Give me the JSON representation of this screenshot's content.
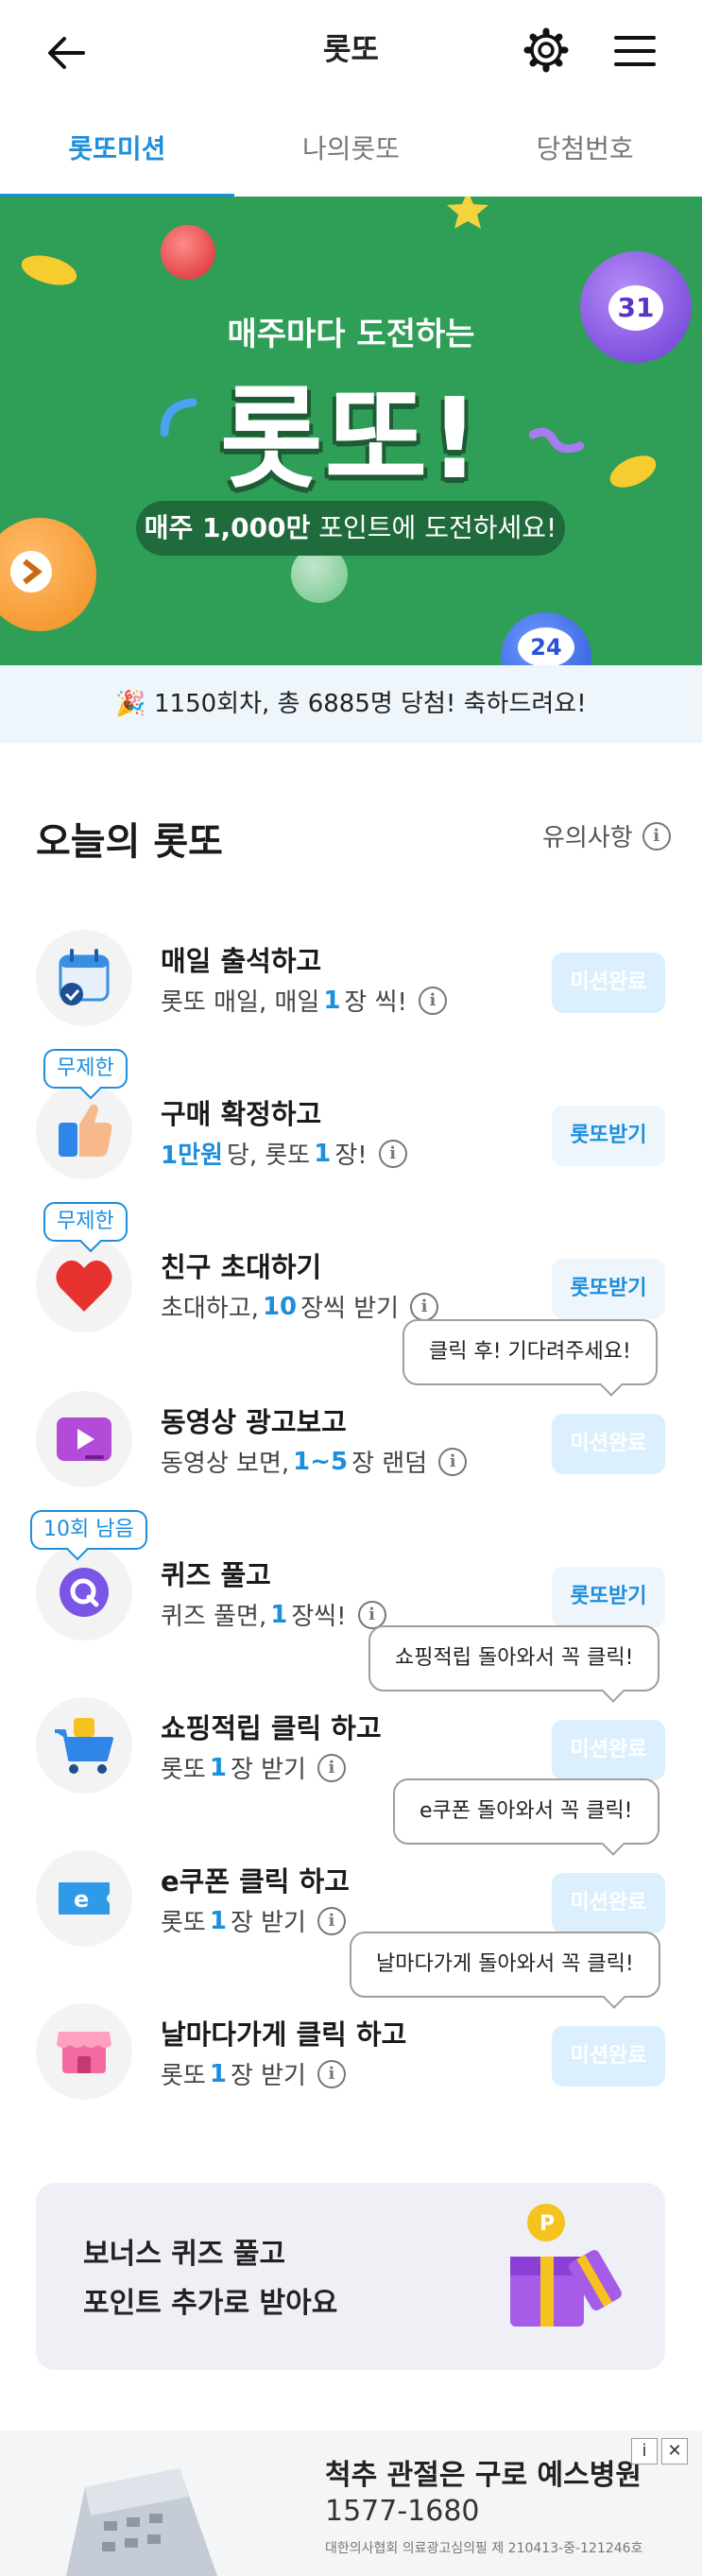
{
  "header": {
    "title": "롯또",
    "back_icon": "arrow-left-icon",
    "settings_icon": "gear-icon",
    "menu_icon": "hamburger-menu-icon"
  },
  "tabs": [
    {
      "label": "롯또미션",
      "active": true
    },
    {
      "label": "나의롯또",
      "active": false
    },
    {
      "label": "당첨번호",
      "active": false
    }
  ],
  "banner": {
    "subtitle": "매주마다 도전하는",
    "headline": "롯또!",
    "pill_bold": "매주 1,000만",
    "pill_rest": " 포인트에 도전하세요!",
    "balls": [
      "31",
      "24"
    ],
    "bg_color": "#2f9e57"
  },
  "notice": {
    "text": "🎉 1150회차, 총 6885명 당첨! 축하드려요!"
  },
  "section": {
    "title": "오늘의 롯또",
    "caution_label": "유의사항"
  },
  "missions": [
    {
      "icon": "calendar-check-icon",
      "title": "매일 출석하고",
      "desc": [
        "롯또 매일, 매일 ",
        "1",
        " 장 씩!"
      ],
      "button": "미션완료",
      "state": "done",
      "badge": ""
    },
    {
      "icon": "thumbs-up-icon",
      "title": "구매 확정하고",
      "desc": [
        "",
        "1만원",
        " 당, 롯또 ",
        "1",
        "장!"
      ],
      "button": "롯또받기",
      "state": "get",
      "badge": "무제한"
    },
    {
      "icon": "heart-icon",
      "title": "친구 초대하기",
      "desc": [
        "초대하고, ",
        "10",
        "장씩 받기"
      ],
      "button": "롯또받기",
      "state": "get",
      "badge": "무제한"
    },
    {
      "icon": "video-play-icon",
      "title": "동영상 광고보고",
      "desc": [
        "동영상 보면, ",
        "1~5",
        "장 랜덤"
      ],
      "button": "미션완료",
      "state": "done",
      "badge": "",
      "tooltip": "클릭 후! 기다려주세요!"
    },
    {
      "icon": "quiz-q-icon",
      "title": "퀴즈 풀고",
      "desc": [
        "퀴즈 풀면, ",
        "1",
        " 장씩!"
      ],
      "button": "롯또받기",
      "state": "get",
      "badge": "10회 남음"
    },
    {
      "icon": "shopping-cart-icon",
      "title": "쇼핑적립 클릭 하고",
      "desc": [
        "롯또 ",
        "1",
        "장 받기"
      ],
      "button": "미션완료",
      "state": "done",
      "badge": "",
      "tooltip": "쇼핑적립 돌아와서 꼭 클릭!"
    },
    {
      "icon": "ecoupon-icon",
      "title": "e쿠폰 클릭 하고",
      "desc": [
        "롯또 ",
        "1",
        "장 받기"
      ],
      "button": "미션완료",
      "state": "done",
      "badge": "",
      "tooltip": "e쿠폰 돌아와서 꼭 클릭!"
    },
    {
      "icon": "store-icon",
      "title": "날마다가게 클릭 하고",
      "desc": [
        "롯또 ",
        "1",
        "장 받기"
      ],
      "button": "미션완료",
      "state": "done",
      "badge": "",
      "tooltip": "날마다가게 돌아와서 꼭 클릭!"
    }
  ],
  "bonus": {
    "line1": "보너스 퀴즈 풀고",
    "line2": "포인트 추가로 받아요",
    "icon": "gift-box-icon",
    "coin_label": "P"
  },
  "ad": {
    "title": "척추 관절은 구로 예스병원",
    "phone": "1577-1680",
    "note": "대한의사협회 의료광고심의필 제 210413-중-121246호",
    "info_label": "i",
    "close_label": "✕"
  },
  "colors": {
    "accent": "#1c8fdc",
    "banner": "#2f9e57",
    "done_button": "#dbeffc"
  }
}
